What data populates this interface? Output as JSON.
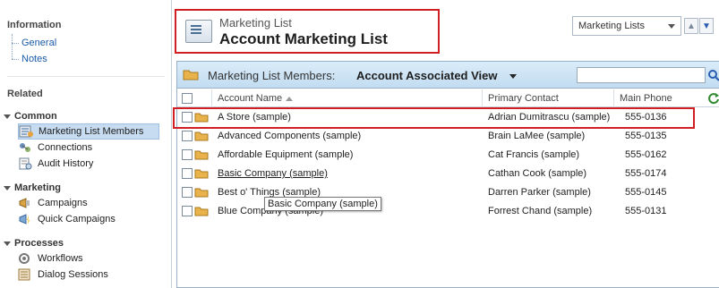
{
  "nav": {
    "information": {
      "title": "Information",
      "links": [
        "General",
        "Notes"
      ]
    },
    "related_title": "Related",
    "groups": [
      {
        "title": "Common",
        "items": [
          "Marketing List Members",
          "Connections",
          "Audit History"
        ]
      },
      {
        "title": "Marketing",
        "items": [
          "Campaigns",
          "Quick Campaigns"
        ]
      },
      {
        "title": "Processes",
        "items": [
          "Workflows",
          "Dialog Sessions"
        ]
      }
    ],
    "selected_item": "Marketing List Members"
  },
  "header": {
    "entity": "Marketing List",
    "record": "Account Marketing List"
  },
  "list_selector": {
    "value": "Marketing Lists"
  },
  "grid": {
    "label": "Marketing List Members:",
    "view": "Account Associated View",
    "search_value": "",
    "columns": [
      "Account Name",
      "Primary Contact",
      "Main Phone"
    ],
    "rows": [
      {
        "name": "A Store (sample)",
        "contact": "Adrian Dumitrascu (sample)",
        "phone": "555-0136"
      },
      {
        "name": "Advanced Components (sample)",
        "contact": "Brain LaMee (sample)",
        "phone": "555-0135"
      },
      {
        "name": "Affordable Equipment (sample)",
        "contact": "Cat Francis (sample)",
        "phone": "555-0162"
      },
      {
        "name": "Basic Company (sample)",
        "contact": "Cathan Cook (sample)",
        "phone": "555-0174"
      },
      {
        "name": "Best o' Things (sample)",
        "contact": "Darren Parker (sample)",
        "phone": "555-0145"
      },
      {
        "name": "Blue Company (sample)",
        "contact": "Forrest Chand (sample)",
        "phone": "555-0131"
      }
    ]
  },
  "tooltip": "Basic Company (sample)",
  "colors": {
    "highlight_red": "#d21f24",
    "link_blue": "#1a5aa8",
    "selected_bg": "#c7dcf1",
    "grid_header_bg": "#c3dcf1"
  }
}
